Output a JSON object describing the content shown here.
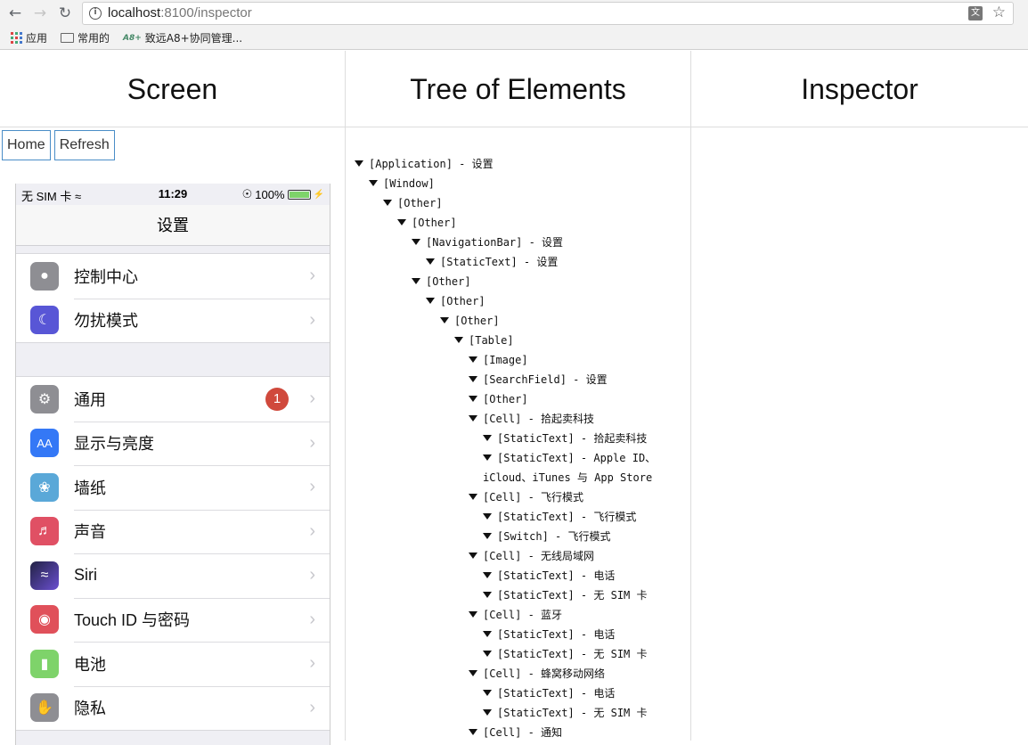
{
  "browser": {
    "url_host": "localhost",
    "url_path": ":8100/inspector",
    "bookmarks": [
      "应用",
      "常用的",
      "致远A8+协同管理..."
    ],
    "seeyon_mark": "A8+"
  },
  "columns": {
    "screen": "Screen",
    "tree": "Tree of Elements",
    "inspector": "Inspector"
  },
  "buttons": {
    "home": "Home",
    "refresh": "Refresh"
  },
  "phone": {
    "carrier": "无 SIM 卡",
    "time": "11:29",
    "battery_pct": "100%",
    "nav_title": "设置",
    "group1": [
      {
        "label": "控制中心",
        "icon": "control-center-icon",
        "color": "#8e8e93"
      },
      {
        "label": "勿扰模式",
        "icon": "moon-icon",
        "color": "#5856d6"
      }
    ],
    "group2": [
      {
        "label": "通用",
        "icon": "gear-icon",
        "color": "#8e8e93",
        "badge": "1"
      },
      {
        "label": "显示与亮度",
        "icon": "display-icon",
        "color": "#3478f6"
      },
      {
        "label": "墙纸",
        "icon": "wallpaper-icon",
        "color": "#5aa8d8"
      },
      {
        "label": "声音",
        "icon": "speaker-icon",
        "color": "#e05064"
      },
      {
        "label": "Siri",
        "icon": "siri-icon",
        "color": "#222244"
      },
      {
        "label": "Touch ID 与密码",
        "icon": "fingerprint-icon",
        "color": "#e0505a"
      },
      {
        "label": "电池",
        "icon": "battery-icon",
        "color": "#7ed36a"
      },
      {
        "label": "隐私",
        "icon": "hand-icon",
        "color": "#8e8e93"
      }
    ]
  },
  "tree": [
    {
      "depth": 0,
      "text": "[Application] - 设置"
    },
    {
      "depth": 1,
      "text": "[Window]"
    },
    {
      "depth": 2,
      "text": "[Other]"
    },
    {
      "depth": 3,
      "text": "[Other]"
    },
    {
      "depth": 4,
      "text": "[NavigationBar] - 设置"
    },
    {
      "depth": 5,
      "text": "[StaticText] - 设置"
    },
    {
      "depth": 4,
      "text": "[Other]"
    },
    {
      "depth": 5,
      "text": "[Other]"
    },
    {
      "depth": 6,
      "text": "[Other]"
    },
    {
      "depth": 7,
      "text": "[Table]"
    },
    {
      "depth": 8,
      "text": "[Image]"
    },
    {
      "depth": 8,
      "text": "[SearchField] - 设置"
    },
    {
      "depth": 8,
      "text": "[Other]"
    },
    {
      "depth": 8,
      "text": "[Cell] - 拾起卖科技"
    },
    {
      "depth": 9,
      "text": "[StaticText] - 拾起卖科技"
    },
    {
      "depth": 9,
      "text": "[StaticText] - Apple ID、iCloud、iTunes 与 App Store",
      "wrap": true
    },
    {
      "depth": 8,
      "text": "[Cell] - 飞行模式"
    },
    {
      "depth": 9,
      "text": "[StaticText] - 飞行模式"
    },
    {
      "depth": 9,
      "text": "[Switch] - 飞行模式"
    },
    {
      "depth": 8,
      "text": "[Cell] - 无线局域网"
    },
    {
      "depth": 9,
      "text": "[StaticText] - 电话"
    },
    {
      "depth": 9,
      "text": "[StaticText] - 无 SIM 卡"
    },
    {
      "depth": 8,
      "text": "[Cell] - 蓝牙"
    },
    {
      "depth": 9,
      "text": "[StaticText] - 电话"
    },
    {
      "depth": 9,
      "text": "[StaticText] - 无 SIM 卡"
    },
    {
      "depth": 8,
      "text": "[Cell] - 蜂窝移动网络"
    },
    {
      "depth": 9,
      "text": "[StaticText] - 电话"
    },
    {
      "depth": 9,
      "text": "[StaticText] - 无 SIM 卡"
    },
    {
      "depth": 8,
      "text": "[Cell] - 通知"
    }
  ]
}
